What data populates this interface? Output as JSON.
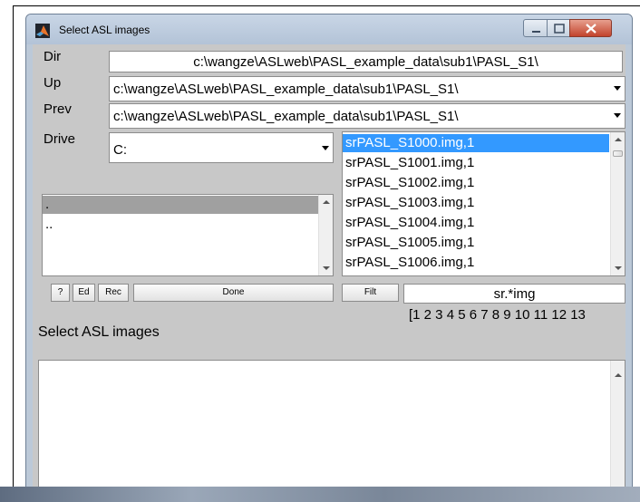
{
  "window": {
    "title": "Select ASL images",
    "icon": "matlab-icon"
  },
  "labels": {
    "dir": "Dir",
    "up": "Up",
    "prev": "Prev",
    "drive": "Drive"
  },
  "dir_value": "c:\\wangze\\ASLweb\\PASL_example_data\\sub1\\PASL_S1\\",
  "up_value": "c:\\wangze\\ASLweb\\PASL_example_data\\sub1\\PASL_S1\\",
  "prev_value": "c:\\wangze\\ASLweb\\PASL_example_data\\sub1\\PASL_S1\\",
  "drive_value": "C:",
  "dir_list": [
    ".",
    ".."
  ],
  "file_list": [
    "srPASL_S1000.img,1",
    "srPASL_S1001.img,1",
    "srPASL_S1002.img,1",
    "srPASL_S1003.img,1",
    "srPASL_S1004.img,1",
    "srPASL_S1005.img,1",
    "srPASL_S1006.img,1"
  ],
  "buttons": {
    "help": "?",
    "edit": "Ed",
    "rec": "Rec",
    "done": "Done",
    "filt": "Filt"
  },
  "filter_value": "sr.*img",
  "frames_value": "[1 2 3 4 5 6 7 8 9 10 11 12 13",
  "prompt": "Select ASL images",
  "colors": {
    "selected": "#3399ff",
    "dir_selected": "#a0a0a0",
    "client_bg": "#c8c8c8"
  }
}
